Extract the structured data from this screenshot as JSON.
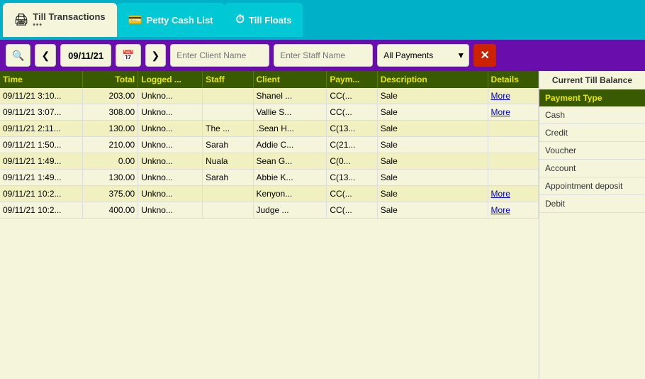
{
  "tabs": [
    {
      "id": "till-transactions",
      "label": "Till Transactions",
      "icon": "🖨",
      "active": true,
      "dots": true
    },
    {
      "id": "petty-cash",
      "label": "Petty Cash List",
      "icon": "💳",
      "active": false,
      "dots": false
    },
    {
      "id": "till-floats",
      "label": "Till Floats",
      "icon": "⏱",
      "active": false,
      "dots": false
    }
  ],
  "toolbar": {
    "search_icon": "🔍",
    "prev_icon": "❮",
    "next_icon": "❯",
    "date": "09/11/21",
    "calendar_icon": "📅",
    "client_placeholder": "Enter Client Name",
    "staff_placeholder": "Enter Staff Name",
    "payment_select_value": "All Payments",
    "payment_options": [
      "All Payments",
      "Cash",
      "Credit",
      "Voucher",
      "Account",
      "Appointment deposit",
      "Debit"
    ],
    "clear_icon": "✕"
  },
  "table": {
    "headers": [
      "Time",
      "Total",
      "Logged ...",
      "Staff",
      "Client",
      "Paym...",
      "Description",
      "Details"
    ],
    "rows": [
      {
        "time": "09/11/21 3:10...",
        "total": "203.00",
        "logged": "Unkno...",
        "staff": "",
        "client": "Shanel ...",
        "payment": "CC(...",
        "description": "Sale",
        "details": "More"
      },
      {
        "time": "09/11/21 3:07...",
        "total": "308.00",
        "logged": "Unkno...",
        "staff": "",
        "client": "Vallie S...",
        "payment": "CC(...",
        "description": "Sale",
        "details": "More"
      },
      {
        "time": "09/11/21 2:11...",
        "total": "130.00",
        "logged": "Unkno...",
        "staff": "The ...",
        "client": ".Sean H...",
        "payment": "C(13...",
        "description": "Sale",
        "details": ""
      },
      {
        "time": "09/11/21 1:50...",
        "total": "210.00",
        "logged": "Unkno...",
        "staff": "Sarah",
        "client": "Addie C...",
        "payment": "C(21...",
        "description": "Sale",
        "details": ""
      },
      {
        "time": "09/11/21 1:49...",
        "total": "0.00",
        "logged": "Unkno...",
        "staff": "Nuala",
        "client": "Sean G...",
        "payment": "C(0...",
        "description": "Sale",
        "details": ""
      },
      {
        "time": "09/11/21 1:49...",
        "total": "130.00",
        "logged": "Unkno...",
        "staff": "Sarah",
        "client": "Abbie K...",
        "payment": "C(13...",
        "description": "Sale",
        "details": ""
      },
      {
        "time": "09/11/21 10:2...",
        "total": "375.00",
        "logged": "Unkno...",
        "staff": "",
        "client": "Kenyon...",
        "payment": "CC(...",
        "description": "Sale",
        "details": "More"
      },
      {
        "time": "09/11/21 10:2...",
        "total": "400.00",
        "logged": "Unkno...",
        "staff": "",
        "client": "Judge ...",
        "payment": "CC(...",
        "description": "Sale",
        "details": "More"
      }
    ]
  },
  "right_panel": {
    "balance_label": "Current Till Balance",
    "payment_type_header": "Payment Type",
    "payment_types": [
      "Cash",
      "Credit",
      "Voucher",
      "Account",
      "Appointment deposit",
      "Debit"
    ]
  }
}
